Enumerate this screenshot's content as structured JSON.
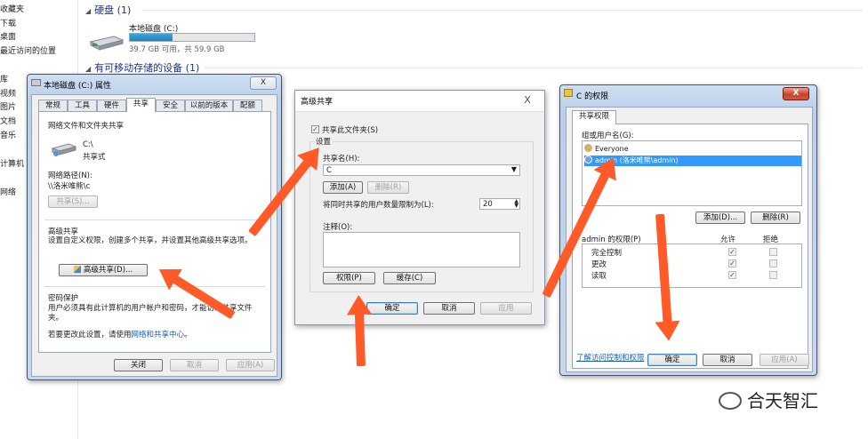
{
  "nav": [
    "收藏夹",
    "下载",
    "桌面",
    "最近访问的位置",
    "库",
    "视频",
    "图片",
    "文档",
    "音乐",
    "计算机",
    "网络"
  ],
  "explorer": {
    "hdd_group": "硬盘 (1)",
    "drive_name": "本地磁盘 (C:)",
    "drive_free": "39.7 GB 可用，共 59.9 GB",
    "drive_used_fraction": 0.34,
    "removable_group": "有可移动存储的设备 (1)"
  },
  "props": {
    "title": "本地磁盘 (C:) 属性",
    "close": "X",
    "tabs_row1": [
      "常规",
      "工具",
      "硬件",
      "共享",
      "安全",
      "以前的版本",
      "配额"
    ],
    "section_share": "网络文件和文件夹共享",
    "share_path_short": "C:\\",
    "share_type": "共享式",
    "network_path_label": "网络路径(N):",
    "network_path": "\\\\洛米唯熊\\c",
    "share_btn": "共享(S)...",
    "section_advanced": "高级共享",
    "advanced_desc": "设置自定义权限，创建多个共享，并设置其他高级共享选项。",
    "advanced_btn": "高级共享(D)...",
    "section_password": "密码保护",
    "password_desc": "用户必须具有此计算机的用户帐户和密码，才能访问共享文件夹。",
    "password_hint_prefix": "若要更改此设置，请使用",
    "password_link": "网络和共享中心",
    "password_hint_suffix": "。",
    "btn_close": "关闭",
    "btn_cancel": "取消",
    "btn_apply": "应用(A)"
  },
  "adv": {
    "title": "高级共享",
    "close": "X",
    "share_check": "共享此文件夹(S)",
    "settings": "设置",
    "share_name_label": "共享名(H):",
    "share_name": "C",
    "add_btn": "添加(A)",
    "delete_btn": "删除(R)",
    "limit_label": "将同时共享的用户数量限制为(L):",
    "limit_value": "20",
    "comment_label": "注释(O):",
    "perm_btn": "权限(P)",
    "cache_btn": "缓存(C)",
    "ok": "确定",
    "cancel": "取消",
    "apply": "应用"
  },
  "perm": {
    "title": "C 的权限",
    "close": "X",
    "tab": "共享权限",
    "group_label": "组或用户名(G):",
    "users": [
      "Everyone",
      "admin (洛米唯熊\\admin)"
    ],
    "add_btn": "添加(D)...",
    "delete_btn": "删除(R)",
    "perm_header": "admin 的权限(P)",
    "allow": "允许",
    "deny": "拒绝",
    "rows": [
      {
        "name": "完全控制",
        "allow": "✓"
      },
      {
        "name": "更改",
        "allow": "✓"
      },
      {
        "name": "读取",
        "allow": "✓"
      }
    ],
    "learn_link": "了解访问控制和权限",
    "ok": "确定",
    "cancel": "取消",
    "apply": "应用(A)"
  },
  "watermark": "合天智汇",
  "accent": "#ff5a28"
}
